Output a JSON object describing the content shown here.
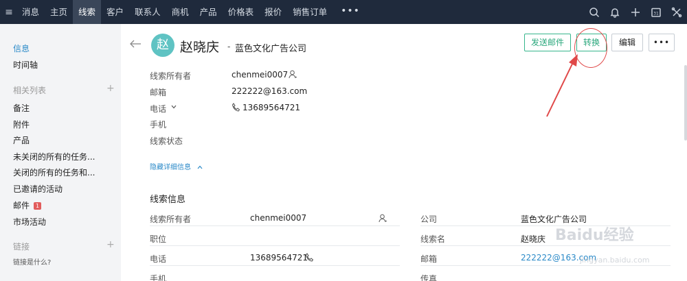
{
  "nav": {
    "items": [
      "消息",
      "主页",
      "线索",
      "客户",
      "联系人",
      "商机",
      "产品",
      "价格表",
      "报价",
      "销售订单"
    ],
    "active_index": 2,
    "more": "•••",
    "right_icons": [
      "search-icon",
      "bell-icon",
      "plus-icon",
      "calendar-icon",
      "settings-icon"
    ],
    "calendar_day": "31"
  },
  "sidebar": {
    "info": "信息",
    "timeline": "时间轴",
    "related_header": "相关列表",
    "related_items": [
      "备注",
      "附件",
      "产品",
      "未关闭的所有的任务...",
      "关闭的所有的任务和...",
      "已邀请的活动",
      "邮件",
      "市场活动"
    ],
    "mail_badge": "1",
    "links_header": "链接",
    "links_help": "链接是什么?"
  },
  "header": {
    "avatar_initial": "赵",
    "name": "赵晓庆",
    "dash": "-",
    "company": "蓝色文化广告公司",
    "buttons": {
      "send_email": "发送邮件",
      "convert": "转换",
      "edit": "编辑",
      "more": "•••"
    }
  },
  "summary": {
    "owner_label": "线索所有者",
    "owner_value": "chenmei0007",
    "email_label": "邮箱",
    "email_value": "222222@163.com",
    "phone_label": "电话",
    "phone_value": "13689564721",
    "mobile_label": "手机",
    "status_label": "线索状态",
    "hide_details": "隐藏详细信息"
  },
  "details": {
    "title": "线索信息",
    "left": {
      "owner_label": "线索所有者",
      "owner_value": "chenmei0007",
      "title_label": "职位",
      "phone_label": "电话",
      "phone_value": "13689564721",
      "mobile_label": "手机"
    },
    "right": {
      "company_label": "公司",
      "company_value": "蓝色文化广告公司",
      "lead_name_label": "线索名",
      "lead_name_value": "赵晓庆",
      "email_label": "邮箱",
      "email_value": "222222@163.com",
      "fax_label": "传真"
    }
  },
  "watermark": {
    "brand": "Baidu经验",
    "url": "jingyan.baidu.com"
  },
  "colors": {
    "nav_bg": "#1f2a3c",
    "accent_blue": "#2b8ac8",
    "green": "#35b58b",
    "annotation_red": "#e04848",
    "avatar": "#5fc3c3"
  }
}
